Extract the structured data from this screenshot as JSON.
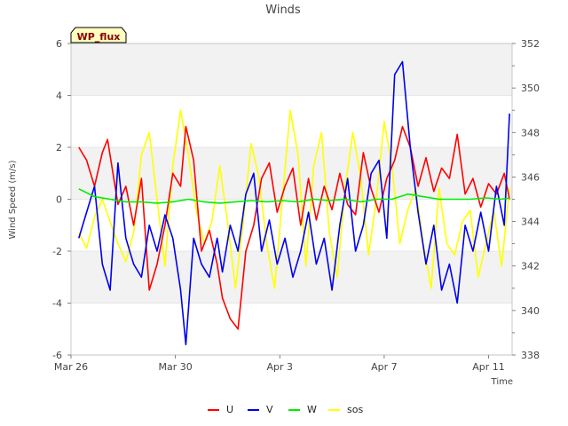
{
  "chart_data": {
    "type": "line",
    "title": "Winds",
    "badge": "WP_flux",
    "xlabel": "Time",
    "ylabel": "Wind Speed (m/s)",
    "ylabel_right": "",
    "x_ticks": [
      "Mar 26",
      "Mar 30",
      "Apr 3",
      "Apr 7",
      "Apr 11"
    ],
    "x_range_days": [
      0,
      16.9
    ],
    "x_start": "Mar 26",
    "ylim": [
      -6,
      6
    ],
    "y_ticks": [
      -6,
      -4,
      -2,
      0,
      2,
      4,
      6
    ],
    "y2lim": [
      338,
      352
    ],
    "y2_ticks": [
      338,
      340,
      342,
      344,
      346,
      348,
      350,
      352
    ],
    "grid": true,
    "legend_position": "bottom-center",
    "series": [
      {
        "name": "U",
        "color": "#ff0000",
        "axis": "left",
        "x": [
          0.3,
          0.6,
          0.9,
          1.2,
          1.4,
          1.8,
          2.1,
          2.4,
          2.7,
          3.0,
          3.3,
          3.6,
          3.9,
          4.2,
          4.4,
          4.7,
          5.0,
          5.3,
          5.6,
          5.8,
          6.1,
          6.4,
          6.7,
          7.0,
          7.3,
          7.6,
          7.9,
          8.2,
          8.5,
          8.8,
          9.1,
          9.4,
          9.7,
          10.0,
          10.3,
          10.6,
          10.9,
          11.2,
          11.5,
          11.8,
          12.1,
          12.4,
          12.7,
          13.0,
          13.3,
          13.6,
          13.9,
          14.2,
          14.5,
          14.8,
          15.1,
          15.4,
          15.7,
          16.0,
          16.3,
          16.6,
          16.8
        ],
        "y": [
          2.0,
          1.5,
          0.5,
          1.8,
          2.3,
          -0.2,
          0.5,
          -1.0,
          0.8,
          -3.5,
          -2.5,
          -1.0,
          1.0,
          0.5,
          2.8,
          1.5,
          -2.0,
          -1.2,
          -2.5,
          -3.8,
          -4.6,
          -5.0,
          -2.0,
          -1.0,
          0.8,
          1.4,
          -0.5,
          0.5,
          1.2,
          -1.0,
          0.8,
          -0.8,
          0.5,
          -0.4,
          1.0,
          -0.2,
          -0.6,
          1.8,
          0.4,
          -0.5,
          0.8,
          1.5,
          2.8,
          2.0,
          0.5,
          1.6,
          0.3,
          1.2,
          0.8,
          2.5,
          0.2,
          0.8,
          -0.3,
          0.6,
          0.2,
          1.0,
          0.0
        ]
      },
      {
        "name": "V",
        "color": "#0000ee",
        "axis": "left",
        "x": [
          0.3,
          0.6,
          0.9,
          1.2,
          1.5,
          1.8,
          2.1,
          2.4,
          2.7,
          3.0,
          3.3,
          3.6,
          3.9,
          4.2,
          4.4,
          4.7,
          5.0,
          5.3,
          5.6,
          5.8,
          6.1,
          6.4,
          6.7,
          7.0,
          7.3,
          7.6,
          7.9,
          8.2,
          8.5,
          8.8,
          9.1,
          9.4,
          9.7,
          10.0,
          10.3,
          10.6,
          10.9,
          11.2,
          11.5,
          11.8,
          12.1,
          12.4,
          12.7,
          13.0,
          13.3,
          13.6,
          13.9,
          14.2,
          14.5,
          14.8,
          15.1,
          15.4,
          15.7,
          16.0,
          16.3,
          16.6,
          16.8
        ],
        "y": [
          -1.5,
          -0.5,
          0.5,
          -2.5,
          -3.5,
          1.4,
          -1.5,
          -2.5,
          -3.0,
          -1.0,
          -2.0,
          -0.6,
          -1.5,
          -3.5,
          -5.6,
          -1.5,
          -2.5,
          -3.0,
          -1.5,
          -2.8,
          -1.0,
          -2.0,
          0.2,
          1.0,
          -2.0,
          -0.8,
          -2.5,
          -1.5,
          -3.0,
          -2.0,
          -0.5,
          -2.5,
          -1.5,
          -3.5,
          -1.0,
          0.8,
          -2.0,
          -1.0,
          1.0,
          1.5,
          -1.5,
          4.8,
          5.3,
          2.0,
          -0.5,
          -2.5,
          -1.0,
          -3.5,
          -2.5,
          -4.0,
          -1.0,
          -2.0,
          -0.5,
          -2.0,
          0.5,
          -1.0,
          3.3
        ]
      },
      {
        "name": "W",
        "color": "#00ee00",
        "axis": "left",
        "x": [
          0.3,
          0.9,
          1.5,
          2.1,
          2.7,
          3.3,
          3.9,
          4.5,
          5.1,
          5.7,
          6.3,
          6.9,
          7.5,
          8.1,
          8.7,
          9.3,
          9.9,
          10.5,
          11.1,
          11.7,
          12.3,
          12.9,
          13.5,
          14.1,
          14.7,
          15.3,
          15.9,
          16.5,
          16.8
        ],
        "y": [
          0.4,
          0.1,
          0.0,
          -0.1,
          -0.1,
          -0.15,
          -0.1,
          0.0,
          -0.1,
          -0.15,
          -0.1,
          -0.05,
          -0.1,
          -0.05,
          -0.1,
          0.0,
          -0.05,
          0.0,
          -0.1,
          0.0,
          0.0,
          0.2,
          0.1,
          0.0,
          0.0,
          0.0,
          0.05,
          0.0,
          0.05
        ]
      },
      {
        "name": "sos",
        "color": "#ffff00",
        "axis": "right",
        "x": [
          0.3,
          0.6,
          0.9,
          1.2,
          1.5,
          1.8,
          2.1,
          2.4,
          2.7,
          3.0,
          3.3,
          3.6,
          3.9,
          4.2,
          4.5,
          4.8,
          5.1,
          5.4,
          5.7,
          6.0,
          6.3,
          6.6,
          6.9,
          7.2,
          7.5,
          7.8,
          8.1,
          8.4,
          8.7,
          9.0,
          9.3,
          9.6,
          9.9,
          10.2,
          10.5,
          10.8,
          11.1,
          11.4,
          11.7,
          12.0,
          12.3,
          12.6,
          12.9,
          13.2,
          13.5,
          13.8,
          14.1,
          14.4,
          14.7,
          15.0,
          15.3,
          15.6,
          15.9,
          16.2,
          16.5,
          16.8
        ],
        "y": [
          343.5,
          342.8,
          344.2,
          345.0,
          344.0,
          343.0,
          342.2,
          343.5,
          347.0,
          348.0,
          345.0,
          342.0,
          346.5,
          349.0,
          347.0,
          344.5,
          343.0,
          344.0,
          346.5,
          344.0,
          341.0,
          344.0,
          347.5,
          346.0,
          343.0,
          341.0,
          345.0,
          349.0,
          347.0,
          342.0,
          346.5,
          348.0,
          343.5,
          341.5,
          345.5,
          348.0,
          346.0,
          342.5,
          345.0,
          348.5,
          346.5,
          343.0,
          344.5,
          345.5,
          343.0,
          341.0,
          345.5,
          343.0,
          342.5,
          344.0,
          344.5,
          341.5,
          343.0,
          344.5,
          342.0,
          345.5
        ]
      }
    ]
  }
}
